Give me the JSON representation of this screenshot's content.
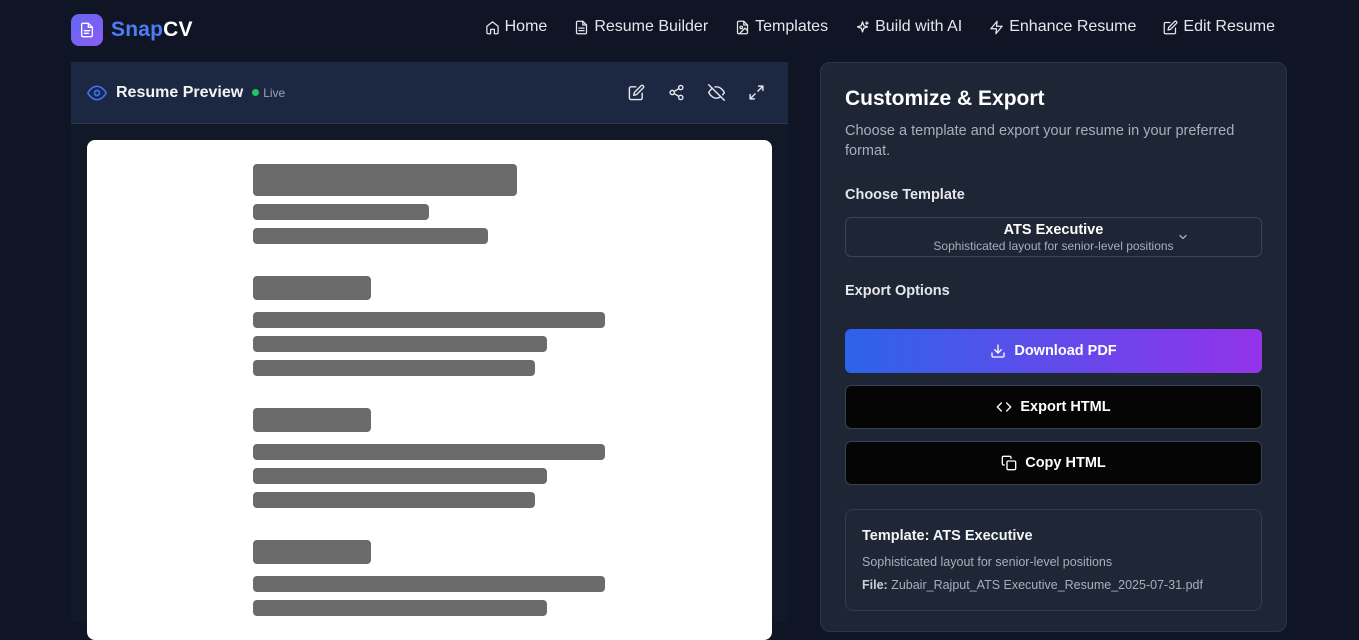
{
  "app": {
    "brand_part1": "Snap",
    "brand_part2": "CV",
    "brand_colors": {
      "snap": "#4f7cf6",
      "cv": "#ffffff",
      "badge": "#6366f1"
    }
  },
  "nav": {
    "items": [
      {
        "label": "Home",
        "icon": "home-icon"
      },
      {
        "label": "Resume Builder",
        "icon": "document-icon"
      },
      {
        "label": "Templates",
        "icon": "file-image-icon"
      },
      {
        "label": "Build with AI",
        "icon": "sparkles-icon"
      },
      {
        "label": "Enhance Resume",
        "icon": "lightning-icon"
      },
      {
        "label": "Edit Resume",
        "icon": "edit-icon"
      }
    ]
  },
  "preview": {
    "title": "Resume Preview",
    "status": "Live",
    "actions": [
      "edit-icon",
      "share-icon",
      "eye-off-icon",
      "expand-icon"
    ]
  },
  "export": {
    "title": "Customize & Export",
    "description": "Choose a template and export your resume in your preferred format.",
    "choose_template_label": "Choose Template",
    "selected_template": {
      "name": "ATS Executive",
      "description": "Sophisticated layout for senior-level positions"
    },
    "export_options_label": "Export Options",
    "buttons": {
      "download_pdf": "Download PDF",
      "export_html": "Export HTML",
      "copy_html": "Copy HTML"
    },
    "info": {
      "title": "Template: ATS Executive",
      "description": "Sophisticated layout for senior-level positions",
      "file_label": "File:",
      "file_name": "Zubair_Rajput_ATS Executive_Resume_2025-07-31.pdf"
    },
    "accent_gradient": [
      "#2d63ea",
      "#9333ea"
    ]
  }
}
